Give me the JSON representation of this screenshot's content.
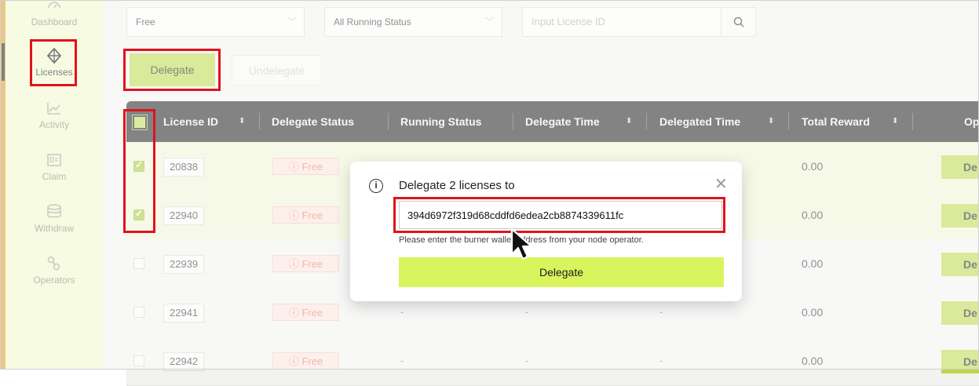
{
  "sidebar": {
    "items": [
      {
        "label": "Dashboard",
        "icon": "dashboard-icon"
      },
      {
        "label": "Licenses",
        "icon": "licenses-icon"
      },
      {
        "label": "Activity",
        "icon": "activity-icon"
      },
      {
        "label": "Claim",
        "icon": "claim-icon"
      },
      {
        "label": "Withdraw",
        "icon": "withdraw-icon"
      },
      {
        "label": "Operators",
        "icon": "operators-icon"
      }
    ]
  },
  "filters": {
    "license_type": "Free",
    "running_status": "All Running Status",
    "license_id_placeholder": "Input License ID"
  },
  "toolbar": {
    "delegate_label": "Delegate",
    "undelegate_label": "Undelegate"
  },
  "table": {
    "columns": [
      "License ID",
      "Delegate Status",
      "Running Status",
      "Delegate Time",
      "Delegated Time",
      "Total Reward",
      "Op"
    ],
    "rows": [
      {
        "id": "20838",
        "status": "Free",
        "running": "",
        "delegate_time": "",
        "delegated_time": "",
        "reward": "0.00",
        "action": "De",
        "checked": true
      },
      {
        "id": "22940",
        "status": "Free",
        "running": "",
        "delegate_time": "",
        "delegated_time": "",
        "reward": "0.00",
        "action": "De",
        "checked": true
      },
      {
        "id": "22939",
        "status": "Free",
        "running": "",
        "delegate_time": "",
        "delegated_time": "",
        "reward": "0.00",
        "action": "De",
        "checked": false
      },
      {
        "id": "22941",
        "status": "Free",
        "running": "-",
        "delegate_time": "-",
        "delegated_time": "-",
        "reward": "0.00",
        "action": "De",
        "checked": false
      },
      {
        "id": "22942",
        "status": "Free",
        "running": "-",
        "delegate_time": "-",
        "delegated_time": "-",
        "reward": "0.00",
        "action": "De",
        "checked": false
      }
    ]
  },
  "modal": {
    "title": "Delegate 2 licenses to",
    "address_value": "394d6972f319d68cddfd6edea2cb8874339611fc",
    "hint": "Please enter the burner wallet address from your node operator.",
    "button_label": "Delegate"
  },
  "colors": {
    "accent": "#bcd848",
    "modal_button": "#d9f45c",
    "highlight_box": "#e0131b",
    "free_badge_text": "#ea7b5c"
  }
}
